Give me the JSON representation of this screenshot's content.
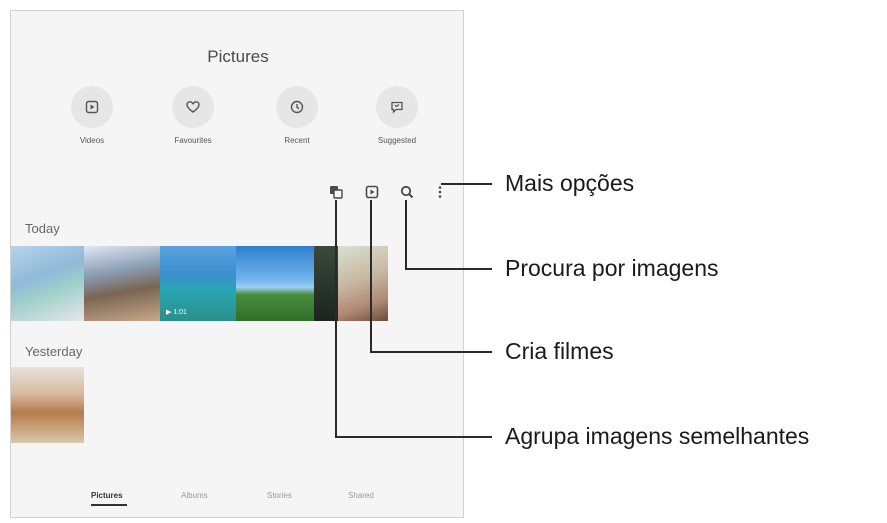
{
  "gallery": {
    "title": "Pictures",
    "quick_access": [
      {
        "label": "Videos",
        "icon": "play-box-icon"
      },
      {
        "label": "Favourites",
        "icon": "heart-icon"
      },
      {
        "label": "Recent",
        "icon": "clock-icon"
      },
      {
        "label": "Suggested",
        "icon": "suggested-chat-icon"
      }
    ],
    "toolbar": {
      "group_similar_icon": "group-similar-icon",
      "create_movie_icon": "create-movie-icon",
      "search_icon": "search-icon",
      "more_options_icon": "more-options-icon"
    },
    "sections": [
      {
        "label": "Today"
      },
      {
        "label": "Yesterday"
      }
    ],
    "video_duration": "▶ 1:01",
    "bottom_nav": [
      {
        "label": "Pictures",
        "active": true
      },
      {
        "label": "Albums",
        "active": false
      },
      {
        "label": "Stories",
        "active": false
      },
      {
        "label": "Shared",
        "active": false
      }
    ]
  },
  "callouts": [
    {
      "label": "Mais opções"
    },
    {
      "label": "Procura por imagens"
    },
    {
      "label": "Cria filmes"
    },
    {
      "label": "Agrupa imagens semelhantes"
    }
  ],
  "colors": {
    "screen_bg": "#f5f5f5",
    "icon_circle": "#e6e6e6",
    "leader_line": "#2a2a2a",
    "text_dark": "#1a1a1a"
  }
}
